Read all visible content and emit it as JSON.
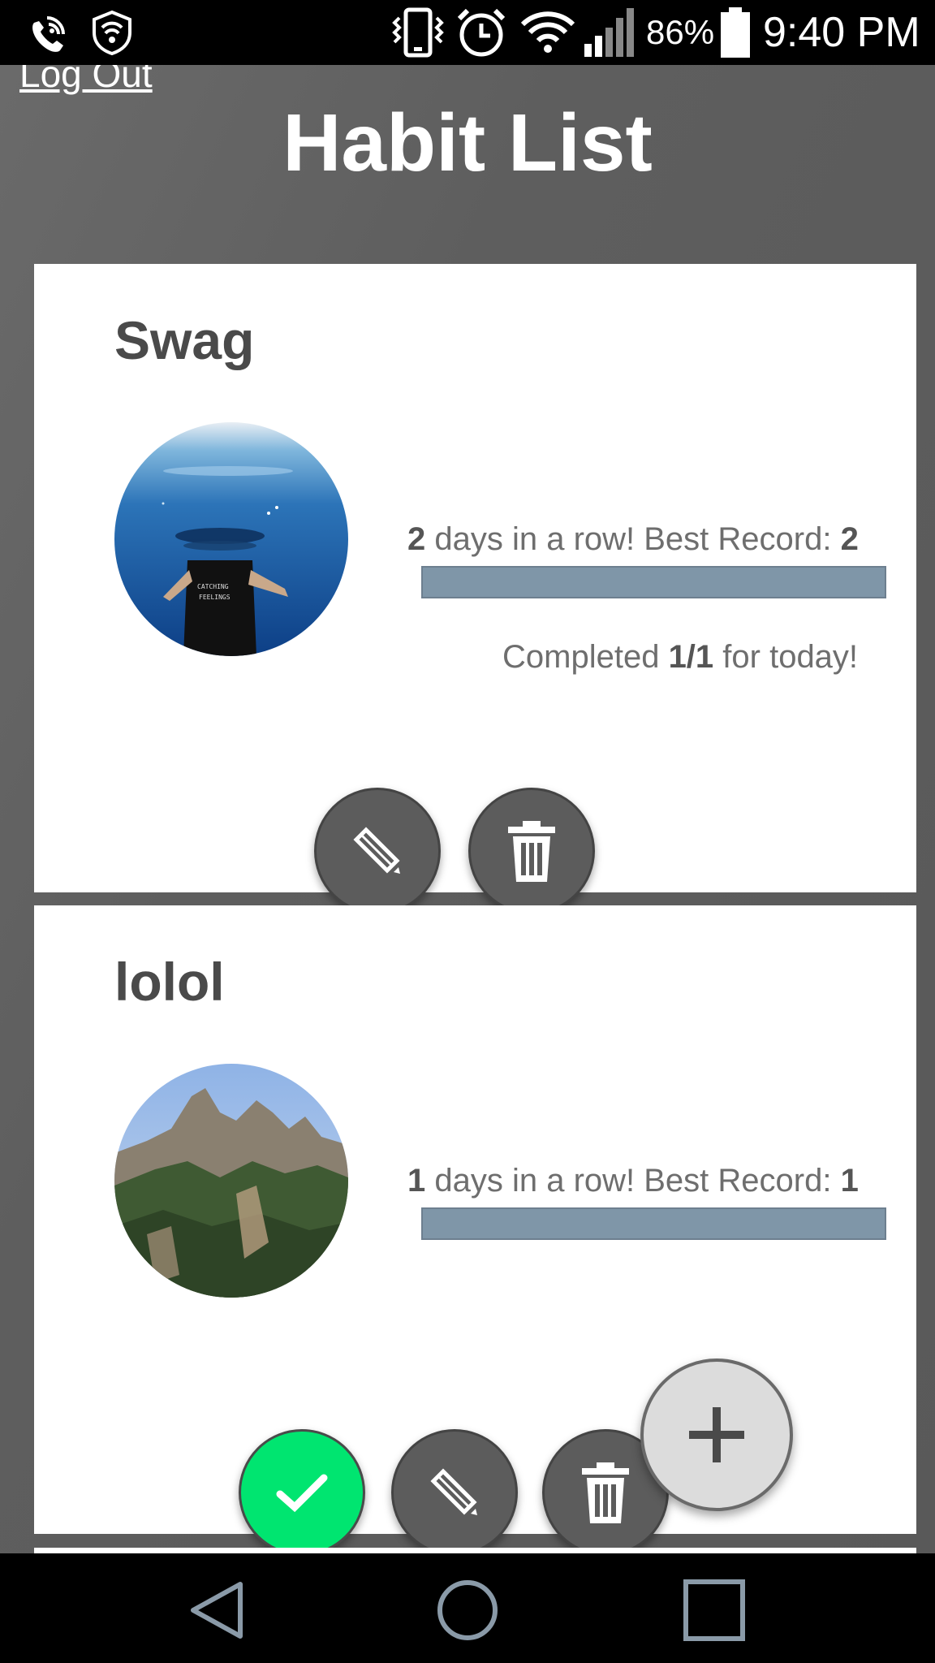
{
  "status_bar": {
    "icons": [
      "wifi-calling-icon",
      "shield-wifi-icon",
      "vibrate-icon",
      "alarm-icon",
      "wifi-icon",
      "signal-icon",
      "battery-icon"
    ],
    "battery_percent": "86%",
    "time": "9:40 PM"
  },
  "header": {
    "logout_label": "Log Out",
    "title": "Habit List"
  },
  "habits": [
    {
      "name": "Swag",
      "image": "underwater-person-photo",
      "streak_count": "2",
      "streak_text": " days in a row! Best Record: ",
      "best_record": "2",
      "progress": 1.0,
      "completed_prefix": "Completed ",
      "completed_value": "1/1",
      "completed_suffix": " for today!",
      "actions": [
        "edit",
        "delete"
      ]
    },
    {
      "name": "lolol",
      "image": "mountain-photo",
      "streak_count": "1",
      "streak_text": " days in a row! Best Record: ",
      "best_record": "1",
      "progress": 1.0,
      "actions": [
        "complete",
        "edit",
        "delete"
      ]
    }
  ],
  "colors": {
    "background": "#5a5a5a",
    "card": "#ffffff",
    "progress_fill": "#7f96a8",
    "done_button": "#00e570",
    "action_button": "#5c5c5c",
    "fab": "#dcdcdc"
  },
  "fab": {
    "icon": "plus-icon"
  },
  "nav_bar": {
    "icons": [
      "back-icon",
      "home-icon",
      "recents-icon"
    ]
  }
}
